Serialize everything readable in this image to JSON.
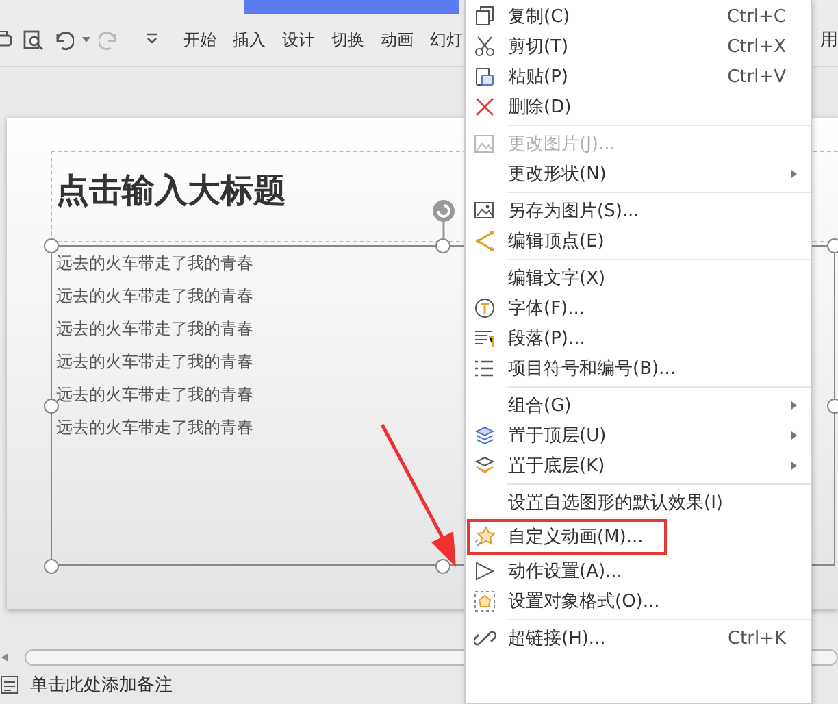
{
  "toolbar": {
    "tabs": [
      {
        "label": "开始",
        "selected": false
      },
      {
        "label": "插入",
        "selected": false
      },
      {
        "label": "设计",
        "selected": false
      },
      {
        "label": "切换",
        "selected": false
      },
      {
        "label": "动画",
        "selected": false
      },
      {
        "label": "幻灯",
        "selected": false
      }
    ],
    "right_text": "用"
  },
  "slide": {
    "title": "点击输入大标题",
    "body_lines": [
      "远去的火车带走了我的青春",
      "远去的火车带走了我的青春",
      "远去的火车带走了我的青春",
      "远去的火车带走了我的青春",
      "远去的火车带走了我的青春",
      "远去的火车带走了我的青春"
    ]
  },
  "notes": {
    "placeholder": "单击此处添加备注"
  },
  "context_menu": {
    "items": [
      {
        "kind": "item",
        "label": "复制(C)",
        "shortcut": "Ctrl+C",
        "submenu": false,
        "disabled": false,
        "highlighted": false
      },
      {
        "kind": "item",
        "label": "剪切(T)",
        "shortcut": "Ctrl+X",
        "submenu": false,
        "disabled": false,
        "highlighted": false
      },
      {
        "kind": "item",
        "label": "粘贴(P)",
        "shortcut": "Ctrl+V",
        "submenu": false,
        "disabled": false,
        "highlighted": false
      },
      {
        "kind": "item",
        "label": "删除(D)",
        "submenu": false,
        "disabled": false,
        "highlighted": false
      },
      {
        "kind": "separator"
      },
      {
        "kind": "item",
        "label": "更改图片(J)...",
        "submenu": false,
        "disabled": true,
        "highlighted": false
      },
      {
        "kind": "item",
        "label": "更改形状(N)",
        "submenu": true,
        "disabled": false,
        "highlighted": false
      },
      {
        "kind": "separator"
      },
      {
        "kind": "item",
        "label": "另存为图片(S)...",
        "submenu": false,
        "disabled": false,
        "highlighted": false
      },
      {
        "kind": "item",
        "label": "编辑顶点(E)",
        "submenu": false,
        "disabled": false,
        "highlighted": false
      },
      {
        "kind": "separator"
      },
      {
        "kind": "item",
        "label": "编辑文字(X)",
        "submenu": false,
        "disabled": false,
        "highlighted": false
      },
      {
        "kind": "item",
        "label": "字体(F)...",
        "submenu": false,
        "disabled": false,
        "highlighted": false
      },
      {
        "kind": "item",
        "label": "段落(P)...",
        "submenu": false,
        "disabled": false,
        "highlighted": false
      },
      {
        "kind": "item",
        "label": "项目符号和编号(B)...",
        "submenu": false,
        "disabled": false,
        "highlighted": false
      },
      {
        "kind": "separator"
      },
      {
        "kind": "item",
        "label": "组合(G)",
        "submenu": true,
        "disabled": false,
        "highlighted": false
      },
      {
        "kind": "item",
        "label": "置于顶层(U)",
        "submenu": true,
        "disabled": false,
        "highlighted": false
      },
      {
        "kind": "item",
        "label": "置于底层(K)",
        "submenu": true,
        "disabled": false,
        "highlighted": false
      },
      {
        "kind": "separator"
      },
      {
        "kind": "item",
        "label": "设置自选图形的默认效果(I)",
        "submenu": false,
        "disabled": false,
        "highlighted": false
      },
      {
        "kind": "item",
        "label": "自定义动画(M)...",
        "submenu": false,
        "disabled": false,
        "highlighted": true
      },
      {
        "kind": "item",
        "label": "动作设置(A)...",
        "submenu": false,
        "disabled": false,
        "highlighted": false
      },
      {
        "kind": "item",
        "label": "设置对象格式(O)...",
        "submenu": false,
        "disabled": false,
        "highlighted": false
      },
      {
        "kind": "separator"
      },
      {
        "kind": "item",
        "label": "超链接(H)...",
        "shortcut": "Ctrl+K",
        "submenu": false,
        "disabled": false,
        "highlighted": false
      }
    ]
  }
}
